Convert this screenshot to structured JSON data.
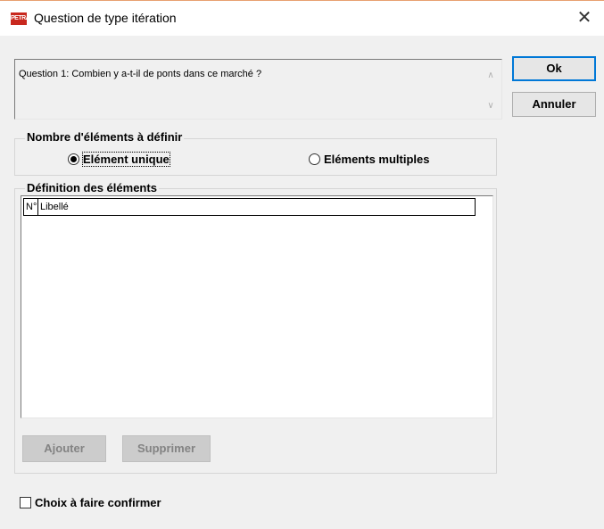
{
  "window": {
    "icon_text": "PETRA",
    "title": "Question de type itération",
    "close_label": "✕"
  },
  "question": {
    "text": "Question 1: Combien y a-t-il de ponts dans ce marché ?"
  },
  "buttons": {
    "ok_label": "Ok",
    "cancel_label": "Annuler",
    "add_label": "Ajouter",
    "delete_label": "Supprimer"
  },
  "count_group": {
    "title": "Nombre d'éléments à définir",
    "options": [
      {
        "label": "Elément unique",
        "selected": true
      },
      {
        "label": "Eléments multiples",
        "selected": false
      }
    ]
  },
  "definition_group": {
    "title": "Définition des éléments",
    "columns": [
      "N°",
      "Libellé"
    ],
    "rows": []
  },
  "confirm": {
    "label": "Choix à faire confirmer",
    "checked": false
  }
}
